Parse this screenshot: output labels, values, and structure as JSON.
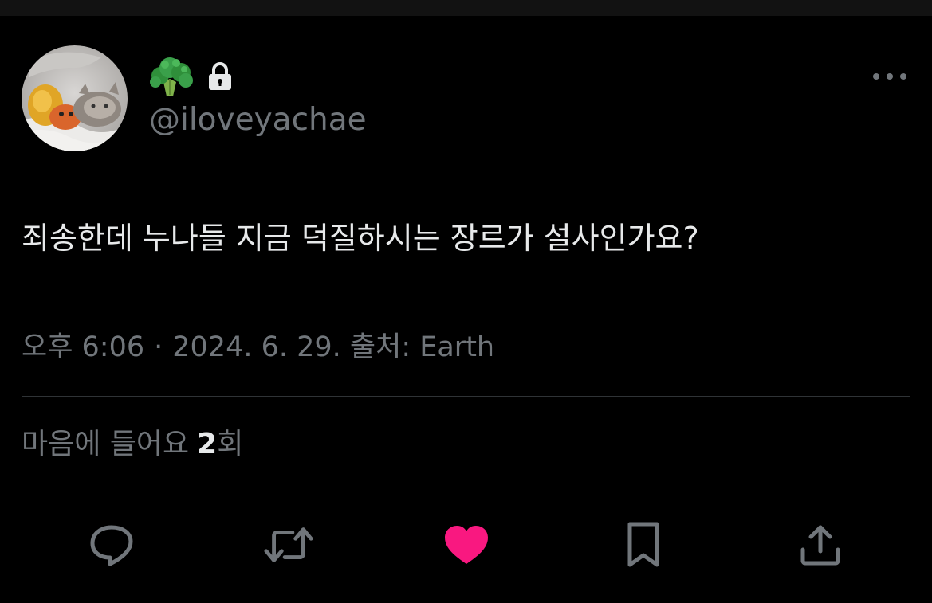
{
  "profile": {
    "display_name_icon": "broccoli-emoji",
    "lock_icon": "lock-icon",
    "handle": "@iloveyachae"
  },
  "tweet": {
    "text": "죄송한데 누나들 지금 덕질하시는 장르가 설사인가요?",
    "time": "오후 6:06",
    "separator": "·",
    "date": "2024. 6. 29.",
    "source": "출처: Earth"
  },
  "stats": {
    "likes_label": "마음에 들어요",
    "likes_count": "2",
    "likes_unit": "회"
  },
  "actions": {
    "reply_icon": "reply-icon",
    "retweet_icon": "retweet-icon",
    "like_icon": "heart-icon",
    "bookmark_icon": "bookmark-icon",
    "share_icon": "share-icon"
  },
  "colors": {
    "background": "#000000",
    "text_primary": "#e7e9ea",
    "text_secondary": "#71767b",
    "divider": "#2f3336",
    "like_active": "#f91880"
  }
}
